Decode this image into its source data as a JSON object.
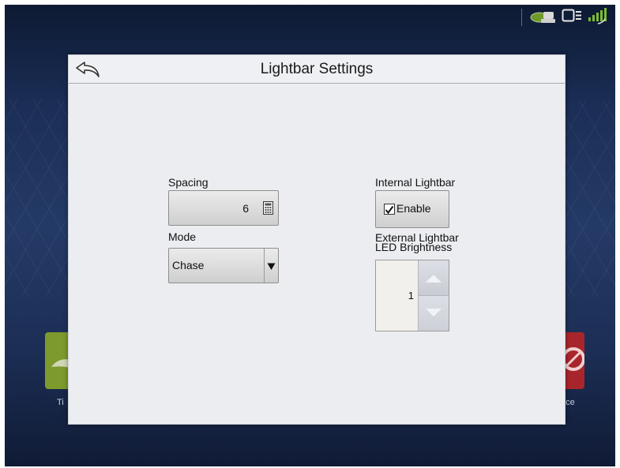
{
  "dialog": {
    "title": "Lightbar Settings",
    "spacing": {
      "label": "Spacing",
      "value": "6"
    },
    "mode": {
      "label": "Mode",
      "value": "Chase"
    },
    "internal_lightbar": {
      "label": "Internal Lightbar",
      "checkbox_label": "Enable",
      "checked": true
    },
    "external_lightbar": {
      "label_line1": "External Lightbar",
      "label_line2": "LED Brightness",
      "value": "1"
    }
  },
  "background": {
    "left_tile_label": "Ti",
    "right_tile_label": "nce"
  },
  "status_icons": [
    "gps-icon",
    "display-icon",
    "satellite-signal-icon"
  ],
  "colors": {
    "accent_green": "#7d9a2c",
    "accent_red": "#a8262b"
  }
}
